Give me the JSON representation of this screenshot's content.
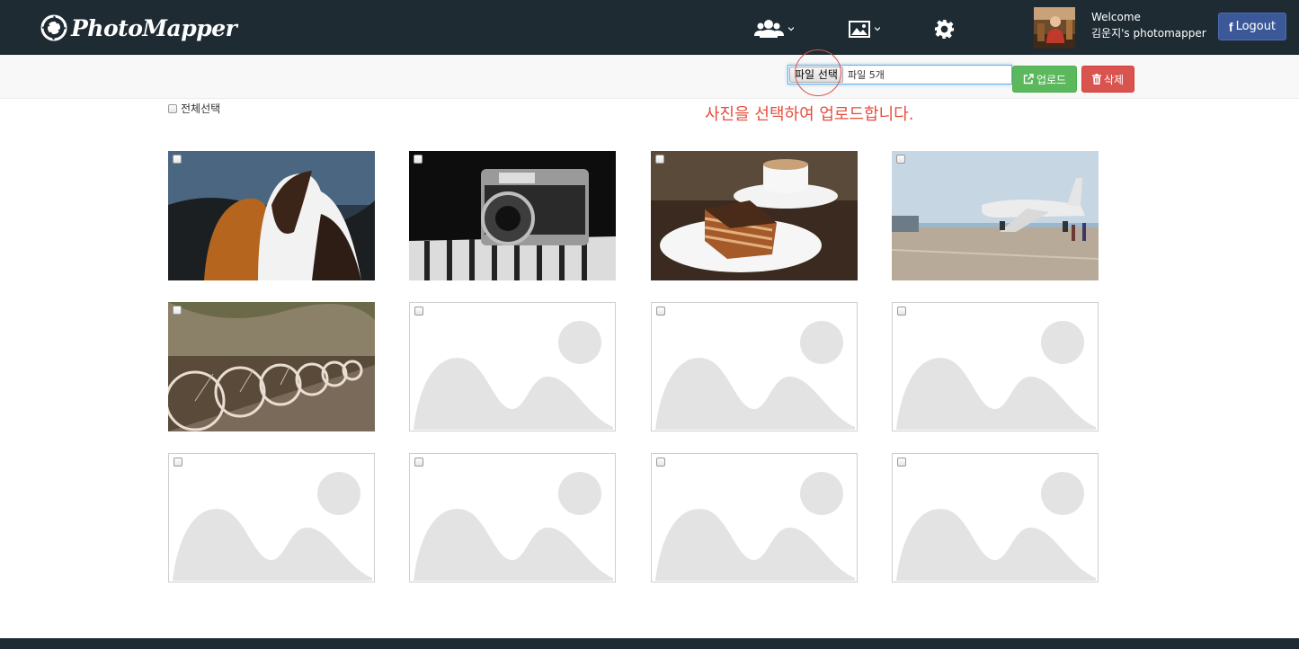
{
  "nav": {
    "brand": "PhotoMapper",
    "icons": [
      "users-icon",
      "image-icon",
      "gear-icon"
    ],
    "welcome": "Welcome",
    "user": "김운지's photomapper",
    "logout_icon": "f",
    "logout": "Logout",
    "colors": {
      "navbar": "#1e2b33",
      "logout": "#3b5998"
    }
  },
  "toolbar": {
    "file_button": "파일 선택",
    "file_status": "파일 5개",
    "upload": "업로드",
    "delete": "삭제",
    "select_all": "전체선택",
    "message": "사진을 선택하여 업로드합니다.",
    "colors": {
      "upload": "#5cb85c",
      "delete": "#d9534f",
      "message": "#e74c3c"
    }
  },
  "grid": {
    "tiles": [
      {
        "type": "photo",
        "subject": "horses"
      },
      {
        "type": "photo",
        "subject": "camera"
      },
      {
        "type": "photo",
        "subject": "cake"
      },
      {
        "type": "photo",
        "subject": "airplane"
      },
      {
        "type": "photo",
        "subject": "bicycles"
      },
      {
        "type": "placeholder"
      },
      {
        "type": "placeholder"
      },
      {
        "type": "placeholder"
      },
      {
        "type": "placeholder"
      },
      {
        "type": "placeholder"
      },
      {
        "type": "placeholder"
      },
      {
        "type": "placeholder"
      }
    ]
  }
}
